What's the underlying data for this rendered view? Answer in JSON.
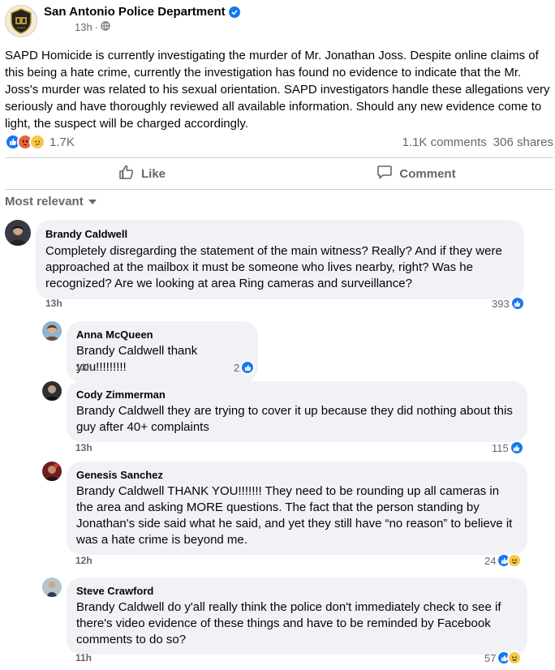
{
  "post": {
    "page_name": "San Antonio Police Department",
    "time": "13h",
    "body": "SAPD Homicide is currently investigating the murder of Mr. Jonathan Joss. Despite online claims of this being a hate crime, currently the investigation has found no evidence to indicate that the Mr. Joss's murder was related to his sexual orientation. SAPD investigators handle these allegations very seriously and have thoroughly reviewed all available information. Should any new evidence come to light, the suspect will be charged accordingly.",
    "reaction_count": "1.7K",
    "comments_count": "1.1K comments",
    "shares_count": "306 shares"
  },
  "actions": {
    "like": "Like",
    "comment": "Comment"
  },
  "sort_label": "Most relevant",
  "colors": {
    "accent": "#1877f2",
    "bubble": "#f0f2f5",
    "muted": "#65676b"
  },
  "comments": [
    {
      "name": "Brandy Caldwell",
      "text": "Completely disregarding the statement of the main witness? Really? And if they were approached at the mailbox it must be someone who lives nearby, right? Was he recognized? Are we looking at area Ring cameras and surveillance?",
      "time": "13h",
      "reactions": "393",
      "reaction_icons": [
        "like-icon"
      ]
    },
    {
      "name": "Anna McQueen",
      "text": "Brandy Caldwell thank you!!!!!!!!!",
      "time": "13h",
      "reactions": "2",
      "reaction_icons": [
        "like-icon"
      ]
    },
    {
      "name": "Cody Zimmerman",
      "text": "Brandy Caldwell they are trying to cover it up because they did nothing about this guy after 40+ complaints",
      "time": "13h",
      "reactions": "115",
      "reaction_icons": [
        "like-icon"
      ]
    },
    {
      "name": "Genesis Sanchez",
      "text": "Brandy Caldwell THANK YOU!!!!!!! They need to be rounding up all cameras in the area and asking MORE questions. The fact that the person standing by Jonathan's side said what he said, and yet they still have “no reason” to believe it was a hate crime is beyond me.",
      "time": "12h",
      "reactions": "24",
      "reaction_icons": [
        "like-icon",
        "haha-icon"
      ]
    },
    {
      "name": "Steve Crawford",
      "text": "Brandy Caldwell do y'all really think the police don't immediately check to see if there's video evidence of these things and have to be reminded by Facebook comments to do so?",
      "time": "11h",
      "reactions": "57",
      "reaction_icons": [
        "like-icon",
        "haha-icon"
      ]
    }
  ]
}
